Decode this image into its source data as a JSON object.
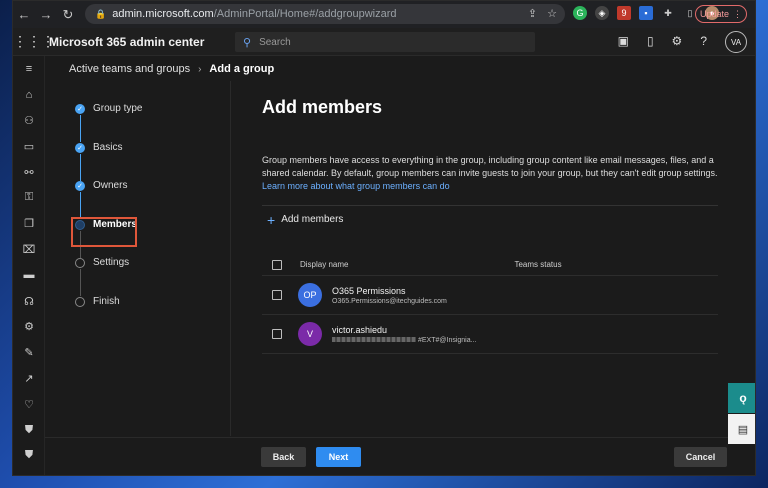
{
  "browser": {
    "url_host": "admin.microsoft.com",
    "url_path": "/AdminPortal/Home#/addgroupwizard",
    "update_label": "Update",
    "ext_badge": "9"
  },
  "header": {
    "app_title": "Microsoft 365 admin center",
    "search_placeholder": "Search",
    "avatar_initials": "VA"
  },
  "breadcrumb": {
    "parent": "Active teams and groups",
    "current": "Add a group"
  },
  "steps": [
    {
      "label": "Group type",
      "state": "done"
    },
    {
      "label": "Basics",
      "state": "done"
    },
    {
      "label": "Owners",
      "state": "done"
    },
    {
      "label": "Members",
      "state": "active"
    },
    {
      "label": "Settings",
      "state": "todo"
    },
    {
      "label": "Finish",
      "state": "todo"
    }
  ],
  "main": {
    "title": "Add members",
    "description": "Group members have access to everything in the group, including group content like email messages, files, and a shared calendar. By default, group members can invite guests to join your group, but they can't edit group settings.",
    "learn_more": "Learn more about what group members can do",
    "add_members_label": "Add members"
  },
  "table": {
    "columns": [
      "Display name",
      "Teams status"
    ],
    "rows": [
      {
        "initials": "OP",
        "name": "O365 Permissions",
        "email": "O365.Permissions@itechguides.com",
        "color": "#3b6fe0"
      },
      {
        "initials": "V",
        "name": "victor.ashiedu",
        "email": "#EXT#@Insignia...",
        "color": "#7b2aa8"
      }
    ]
  },
  "footer": {
    "back": "Back",
    "next": "Next",
    "cancel": "Cancel"
  },
  "colors": {
    "accent": "#2f8cf0",
    "highlight": "#e0573a"
  }
}
